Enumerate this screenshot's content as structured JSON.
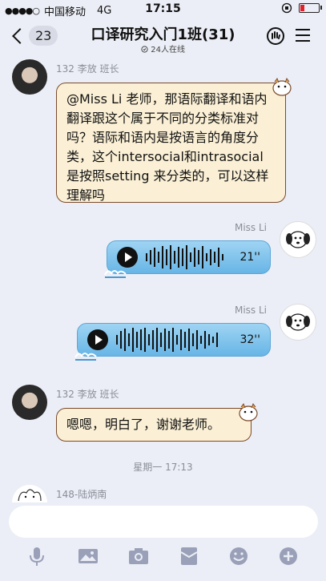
{
  "status_bar": {
    "carrier": "中国移动",
    "network": "4G",
    "time": "17:15"
  },
  "nav": {
    "unread_count": "23",
    "title": "口译研究入门1班(31)",
    "online": "24人在线"
  },
  "messages": [
    {
      "sender": "132 李放 班长",
      "text": "@Miss Li 老师，那语际翻译和语内翻译跟这个属于不同的分类标准对吗？语际和语内是按语言的角度分类，这个intersocial和intrasocial 是按照setting 来分类的，可以这样理解吗"
    },
    {
      "sender": "Miss Li",
      "duration": "21''"
    },
    {
      "sender": "Miss Li",
      "duration": "32''"
    },
    {
      "sender": "132 李放 班长",
      "text": "嗯嗯，明白了，谢谢老师。"
    }
  ],
  "timestamp": "星期一 17:13",
  "last_sender": "148-陆炳南",
  "input": {
    "placeholder": ""
  }
}
